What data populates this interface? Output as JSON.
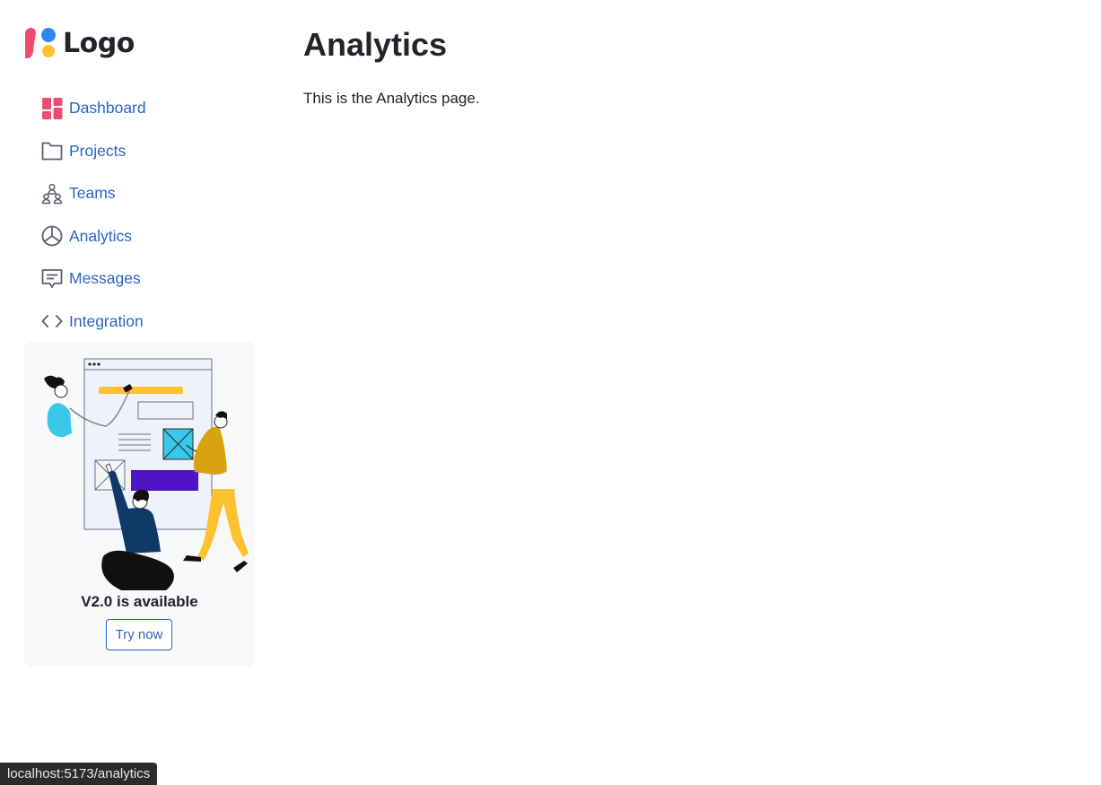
{
  "brand": {
    "logo_text": "Logo"
  },
  "sidebar": {
    "items": [
      {
        "label": "Dashboard",
        "icon": "dashboard-icon"
      },
      {
        "label": "Projects",
        "icon": "folder-icon"
      },
      {
        "label": "Teams",
        "icon": "teams-icon"
      },
      {
        "label": "Analytics",
        "icon": "pie-chart-icon"
      },
      {
        "label": "Messages",
        "icon": "message-icon"
      },
      {
        "label": "Integration",
        "icon": "code-icon"
      }
    ],
    "promo": {
      "title": "V2.0 is available",
      "button_label": "Try now"
    }
  },
  "main": {
    "title": "Analytics",
    "description": "This is the Analytics page."
  },
  "status_bar": {
    "url": "localhost:5173/analytics"
  },
  "colors": {
    "link": "#2b63c4",
    "accent_pink": "#ef4b6f",
    "accent_blue": "#2f86f5",
    "accent_yellow": "#ffc12e"
  }
}
